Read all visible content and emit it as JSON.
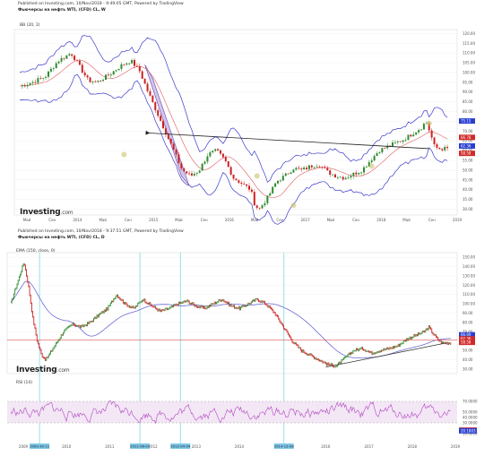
{
  "top": {
    "published": "Published on Investing.com, 10/Nov/2018 - 9:49:05 GMT, Powered by TradingView",
    "title": "Фьючерсы на нефть WTI, (CFD) CL, W",
    "indicator": "BB (20, 2)",
    "logo": "Investing",
    "logo_suffix": ".com"
  },
  "bottom": {
    "published": "Published on Investing.com, 10/Nov/2018 - 9:37:51 GMT, Powered by TradingView",
    "title": "Фьючерсы на нефть WTI, (CFD) CL, D",
    "indicator": "EMA (150, close, 0)",
    "rsi_label": "RSI (14)",
    "logo": "Investing",
    "logo_suffix": ".com"
  },
  "colors": {
    "up": "#2e8b2e",
    "down": "#cc2222",
    "bb_band": "#3b3bcc",
    "bb_mid": "#e05a5a",
    "ema": "#6b6bd6",
    "rsi": "#b04bc0",
    "hline": "#e03030",
    "vline": "#7fd6e6",
    "highlight": "#9b7fd0",
    "badge_blue": "#2a3fd0",
    "badge_red": "#d02a2a"
  },
  "chart_data": [
    {
      "type": "candlestick",
      "interval": "W",
      "x_ticks": [
        "Май",
        "Сен",
        "2014",
        "Май",
        "Сен",
        "2015",
        "Май",
        "Сен",
        "2016",
        "Май",
        "Сен",
        "2017",
        "Май",
        "Сен",
        "2018",
        "Май",
        "Сен",
        "2019"
      ],
      "y_ticks": [
        "120.00",
        "115.00",
        "110.00",
        "105.00",
        "100.00",
        "95.00",
        "90.00",
        "85.00",
        "80.00",
        "75.00",
        "70.00",
        "65.00",
        "60.00",
        "55.00",
        "50.00",
        "45.00",
        "40.00",
        "35.00",
        "30.00"
      ],
      "ylim": [
        27,
        122
      ],
      "price_path": [
        [
          0,
          93
        ],
        [
          3,
          95
        ],
        [
          6,
          98
        ],
        [
          9,
          106
        ],
        [
          12,
          110
        ],
        [
          14,
          103
        ],
        [
          16,
          96
        ],
        [
          18,
          95
        ],
        [
          21,
          99
        ],
        [
          24,
          104
        ],
        [
          26,
          106
        ],
        [
          28,
          101
        ],
        [
          30,
          90
        ],
        [
          32,
          80
        ],
        [
          34,
          70
        ],
        [
          36,
          60
        ],
        [
          38,
          50
        ],
        [
          40,
          47
        ],
        [
          42,
          50
        ],
        [
          44,
          58
        ],
        [
          46,
          60
        ],
        [
          48,
          55
        ],
        [
          50,
          46
        ],
        [
          52,
          43
        ],
        [
          54,
          40
        ],
        [
          55,
          32
        ],
        [
          56,
          30
        ],
        [
          58,
          36
        ],
        [
          60,
          44
        ],
        [
          62,
          47
        ],
        [
          64,
          51
        ],
        [
          66,
          50
        ],
        [
          68,
          52
        ],
        [
          70,
          53
        ],
        [
          72,
          49
        ],
        [
          74,
          47
        ],
        [
          76,
          46
        ],
        [
          78,
          48
        ],
        [
          80,
          50
        ],
        [
          82,
          55
        ],
        [
          84,
          60
        ],
        [
          86,
          62
        ],
        [
          88,
          64
        ],
        [
          90,
          66
        ],
        [
          92,
          69
        ],
        [
          94,
          72
        ],
        [
          95,
          75
        ],
        [
          96,
          69
        ],
        [
          97,
          62
        ],
        [
          98,
          61
        ]
      ],
      "badges": [
        "75.15",
        "66.78",
        "62.36",
        "58.58"
      ],
      "annotations": [
        "arrow from 2018 low back to 2014 breakdown",
        "highlighted 2014 decline channel"
      ]
    },
    {
      "type": "line",
      "interval": "D",
      "x_ticks": [
        "2009",
        "2010",
        "2011",
        "2012",
        "2013",
        "2014",
        "2015",
        "2016",
        "2017",
        "2018",
        "2019"
      ],
      "y_ticks": [
        "150.00",
        "140.00",
        "130.00",
        "120.00",
        "110.00",
        "100.00",
        "90.00",
        "80.00",
        "70.00",
        "60.00",
        "50.00",
        "40.00",
        "30.00"
      ],
      "ylim": [
        25,
        155
      ],
      "price_path": [
        [
          0,
          100
        ],
        [
          1,
          115
        ],
        [
          2,
          130
        ],
        [
          3,
          145
        ],
        [
          4,
          120
        ],
        [
          5,
          85
        ],
        [
          6,
          60
        ],
        [
          7,
          45
        ],
        [
          8,
          40
        ],
        [
          10,
          55
        ],
        [
          12,
          70
        ],
        [
          14,
          78
        ],
        [
          16,
          75
        ],
        [
          18,
          80
        ],
        [
          20,
          88
        ],
        [
          22,
          95
        ],
        [
          24,
          110
        ],
        [
          26,
          100
        ],
        [
          28,
          95
        ],
        [
          30,
          105
        ],
        [
          32,
          98
        ],
        [
          34,
          92
        ],
        [
          36,
          95
        ],
        [
          38,
          100
        ],
        [
          40,
          103
        ],
        [
          42,
          98
        ],
        [
          44,
          95
        ],
        [
          46,
          100
        ],
        [
          48,
          105
        ],
        [
          50,
          98
        ],
        [
          52,
          95
        ],
        [
          54,
          100
        ],
        [
          56,
          105
        ],
        [
          58,
          100
        ],
        [
          60,
          90
        ],
        [
          62,
          75
        ],
        [
          64,
          60
        ],
        [
          65,
          55
        ],
        [
          66,
          50
        ],
        [
          68,
          45
        ],
        [
          70,
          40
        ],
        [
          72,
          35
        ],
        [
          74,
          33
        ],
        [
          76,
          42
        ],
        [
          78,
          50
        ],
        [
          80,
          52
        ],
        [
          82,
          47
        ],
        [
          84,
          50
        ],
        [
          86,
          52
        ],
        [
          88,
          55
        ],
        [
          90,
          62
        ],
        [
          92,
          66
        ],
        [
          94,
          70
        ],
        [
          95,
          75
        ],
        [
          96,
          68
        ],
        [
          97,
          62
        ],
        [
          98,
          58
        ]
      ],
      "badges": [
        "66.69",
        "62.36",
        "58.58"
      ],
      "vertical_markers": [
        "2009-30-11",
        "2011-06-03",
        "2012-04-04",
        "2014-12-08"
      ],
      "rsi": {
        "y_ticks": [
          "70.0000",
          "50.0000",
          "40.0000",
          "30.0000",
          "10.0000"
        ],
        "ylim": [
          0,
          100
        ],
        "badges": [
          "13.1001",
          "20.1803"
        ]
      }
    }
  ]
}
